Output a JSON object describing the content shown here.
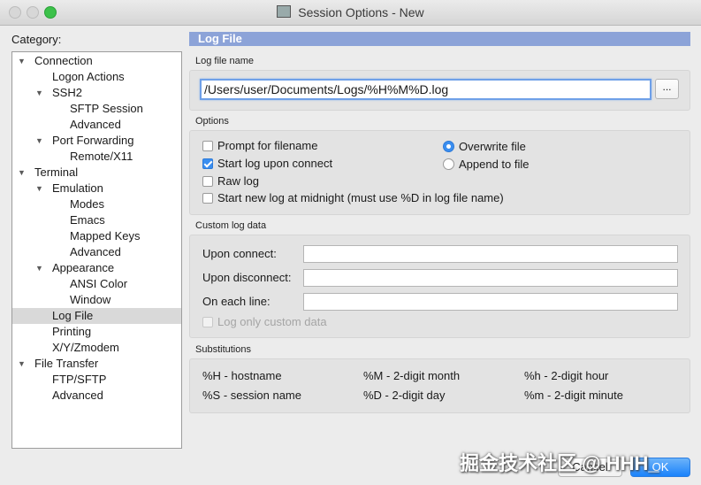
{
  "window": {
    "title": "Session Options - New"
  },
  "sidebar": {
    "category_label": "Category:",
    "items": [
      {
        "label": "Connection",
        "expanded": true
      },
      {
        "label": "Logon Actions"
      },
      {
        "label": "SSH2",
        "expanded": true
      },
      {
        "label": "SFTP Session"
      },
      {
        "label": "Advanced"
      },
      {
        "label": "Port Forwarding",
        "expanded": true
      },
      {
        "label": "Remote/X11"
      },
      {
        "label": "Terminal",
        "expanded": true
      },
      {
        "label": "Emulation",
        "expanded": true
      },
      {
        "label": "Modes"
      },
      {
        "label": "Emacs"
      },
      {
        "label": "Mapped Keys"
      },
      {
        "label": "Advanced"
      },
      {
        "label": "Appearance",
        "expanded": true
      },
      {
        "label": "ANSI Color"
      },
      {
        "label": "Window"
      },
      {
        "label": "Log File",
        "selected": true
      },
      {
        "label": "Printing"
      },
      {
        "label": "X/Y/Zmodem"
      },
      {
        "label": "File Transfer",
        "expanded": true
      },
      {
        "label": "FTP/SFTP"
      },
      {
        "label": "Advanced"
      }
    ]
  },
  "panel": {
    "title": "Log File",
    "log_file_name": {
      "section_label": "Log file name",
      "value": "/Users/user/Documents/Logs/%H%M%D.log",
      "browse_label": "..."
    },
    "options": {
      "section_label": "Options",
      "prompt_for_filename": {
        "label": "Prompt for filename",
        "checked": false
      },
      "start_log_upon_connect": {
        "label": "Start log upon connect",
        "checked": true
      },
      "raw_log": {
        "label": "Raw log",
        "checked": false
      },
      "start_new_log_midnight": {
        "label": "Start new log at midnight (must use %D in log file name)",
        "checked": false
      },
      "overwrite_file": {
        "label": "Overwrite file",
        "selected": true
      },
      "append_to_file": {
        "label": "Append to file",
        "selected": false
      }
    },
    "custom_log_data": {
      "section_label": "Custom log data",
      "upon_connect": {
        "label": "Upon connect:",
        "value": ""
      },
      "upon_disconnect": {
        "label": "Upon disconnect:",
        "value": ""
      },
      "on_each_line": {
        "label": "On each line:",
        "value": ""
      },
      "log_only_custom": {
        "label": "Log only custom data",
        "checked": false,
        "disabled": true
      }
    },
    "substitutions": {
      "section_label": "Substitutions",
      "items": [
        "%H - hostname",
        "%M - 2-digit month",
        "%h - 2-digit hour",
        "%S - session name",
        "%D - 2-digit day",
        "%m - 2-digit minute"
      ]
    }
  },
  "footer": {
    "cancel_label": "Cancel",
    "ok_label": "OK"
  },
  "watermark": "掘金技术社区 @ HHH_",
  "colors": {
    "header_bg": "#8ca3d8",
    "accent_blue": "#3a8ef0",
    "selection_bg": "#d9d9d9"
  }
}
